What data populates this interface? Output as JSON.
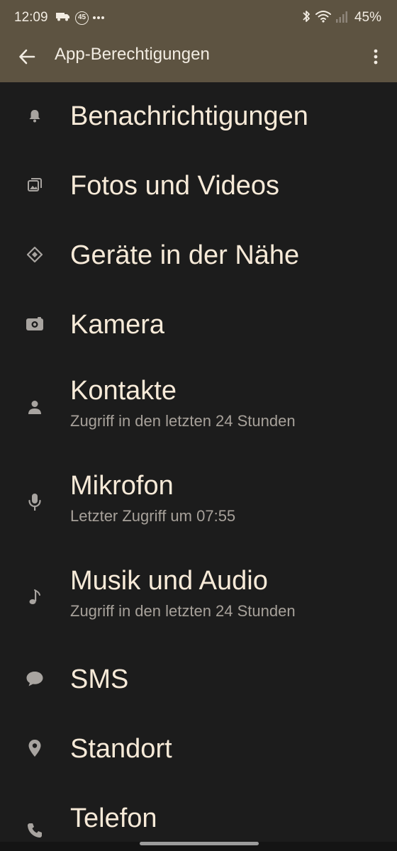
{
  "status_bar": {
    "time": "12:09",
    "badge_number": "45",
    "battery": "45%",
    "icons": [
      "truck-icon",
      "badge-45-icon",
      "more-notifications-icon",
      "bluetooth-icon",
      "wifi-icon",
      "signal-icon"
    ]
  },
  "app_bar": {
    "title": "App-Berechtigungen",
    "back_icon": "arrow-back-icon",
    "menu_icon": "more-vert-icon",
    "background": "#5d5341"
  },
  "permissions": [
    {
      "label": "Benachrichtigungen",
      "icon": "bell-icon"
    },
    {
      "label": "Fotos und Videos",
      "icon": "photos-icon"
    },
    {
      "label": "Geräte in der Nähe",
      "icon": "nearby-devices-icon"
    },
    {
      "label": "Kamera",
      "icon": "camera-icon"
    },
    {
      "label": "Kontakte",
      "subtitle": "Zugriff in den letzten 24 Stunden",
      "icon": "contacts-icon"
    },
    {
      "label": "Mikrofon",
      "subtitle": "Letzter Zugriff um 07:55",
      "icon": "microphone-icon"
    },
    {
      "label": "Musik und Audio",
      "subtitle": "Zugriff in den letzten 24 Stunden",
      "icon": "music-note-icon"
    },
    {
      "label": "SMS",
      "icon": "sms-icon"
    },
    {
      "label": "Standort",
      "icon": "location-icon"
    },
    {
      "label": "Telefon",
      "icon": "phone-icon"
    }
  ],
  "colors": {
    "background": "#1c1c1c",
    "label": "#f7ead8",
    "subtitle": "#a7a19a",
    "icon": "#a8a4a0"
  }
}
